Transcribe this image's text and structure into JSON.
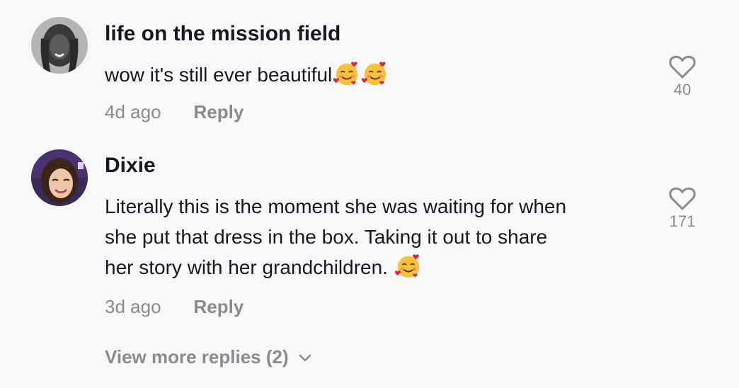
{
  "comments": [
    {
      "username": "life on the mission field",
      "text": "wow it's still ever beautiful",
      "emojis": [
        "smiling-face-with-hearts-emoji",
        "smiling-face-with-hearts-emoji"
      ],
      "time": "4d ago",
      "reply_label": "Reply",
      "likes": "40",
      "avatar_icon": "user-avatar"
    },
    {
      "username": "Dixie",
      "text_lines": [
        "Literally this is the moment she was waiting for when",
        "she put that dress in the box. Taking it out to share",
        "her story with her grandchildren. "
      ],
      "emojis": [
        "smiling-face-with-hearts-emoji"
      ],
      "time": "3d ago",
      "reply_label": "Reply",
      "likes": "171",
      "avatar_icon": "user-avatar"
    }
  ],
  "view_more_replies": "View more replies (2)",
  "colors": {
    "background": "#f8f8f8",
    "primary_text": "#161823",
    "secondary_text": "#8a8b91"
  }
}
